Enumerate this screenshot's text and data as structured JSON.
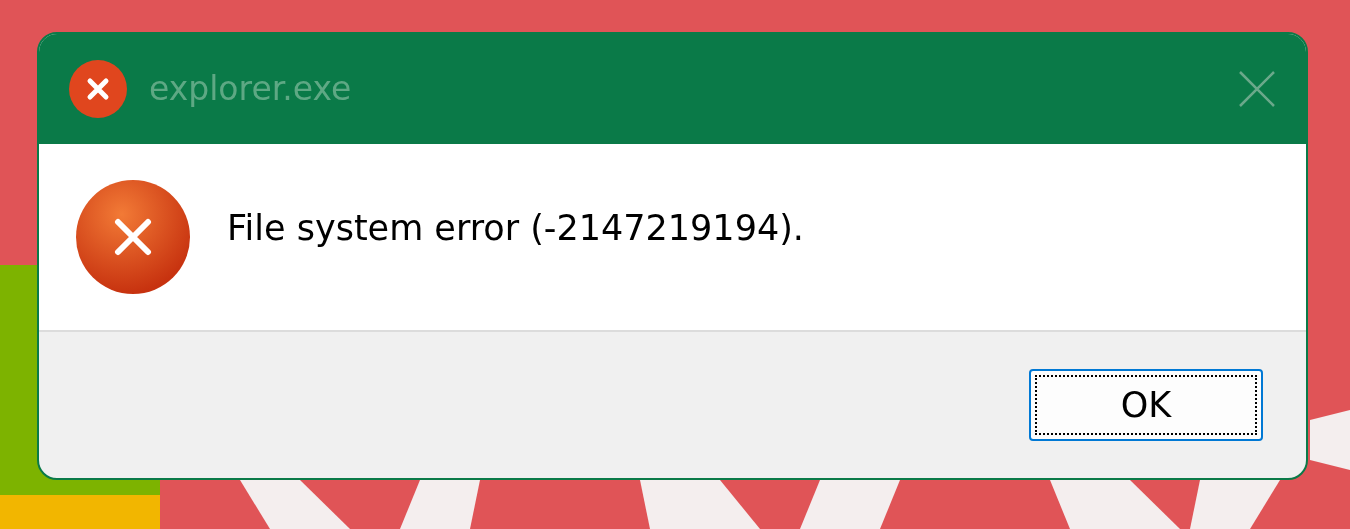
{
  "window": {
    "title": "explorer.exe"
  },
  "message": "File system error (-2147219194).",
  "buttons": [
    {
      "label": "OK",
      "focused": true
    }
  ]
}
